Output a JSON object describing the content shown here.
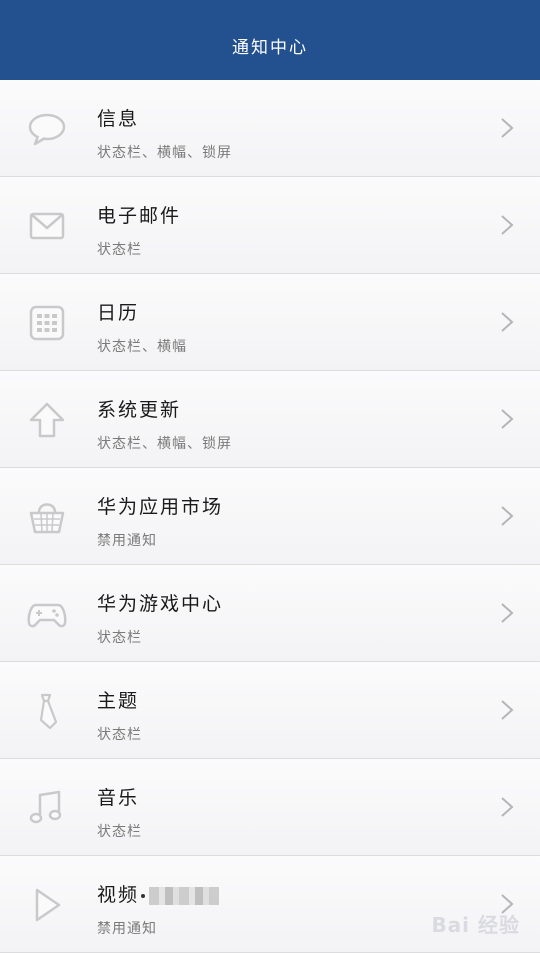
{
  "header": {
    "title": "通知中心"
  },
  "items": [
    {
      "title": "信息",
      "subtitle": "状态栏、横幅、锁屏",
      "icon": "speech-bubble-icon"
    },
    {
      "title": "电子邮件",
      "subtitle": "状态栏",
      "icon": "envelope-icon"
    },
    {
      "title": "日历",
      "subtitle": "状态栏、横幅",
      "icon": "calendar-icon"
    },
    {
      "title": "系统更新",
      "subtitle": "状态栏、横幅、锁屏",
      "icon": "up-arrow-icon"
    },
    {
      "title": "华为应用市场",
      "subtitle": "禁用通知",
      "icon": "basket-icon"
    },
    {
      "title": "华为游戏中心",
      "subtitle": "状态栏",
      "icon": "gamepad-icon"
    },
    {
      "title": "主题",
      "subtitle": "状态栏",
      "icon": "tie-icon"
    },
    {
      "title": "音乐",
      "subtitle": "状态栏",
      "icon": "music-note-icon"
    },
    {
      "title": "视频",
      "subtitle": "禁用通知",
      "icon": "play-icon"
    }
  ],
  "watermark": "Bai 经验"
}
